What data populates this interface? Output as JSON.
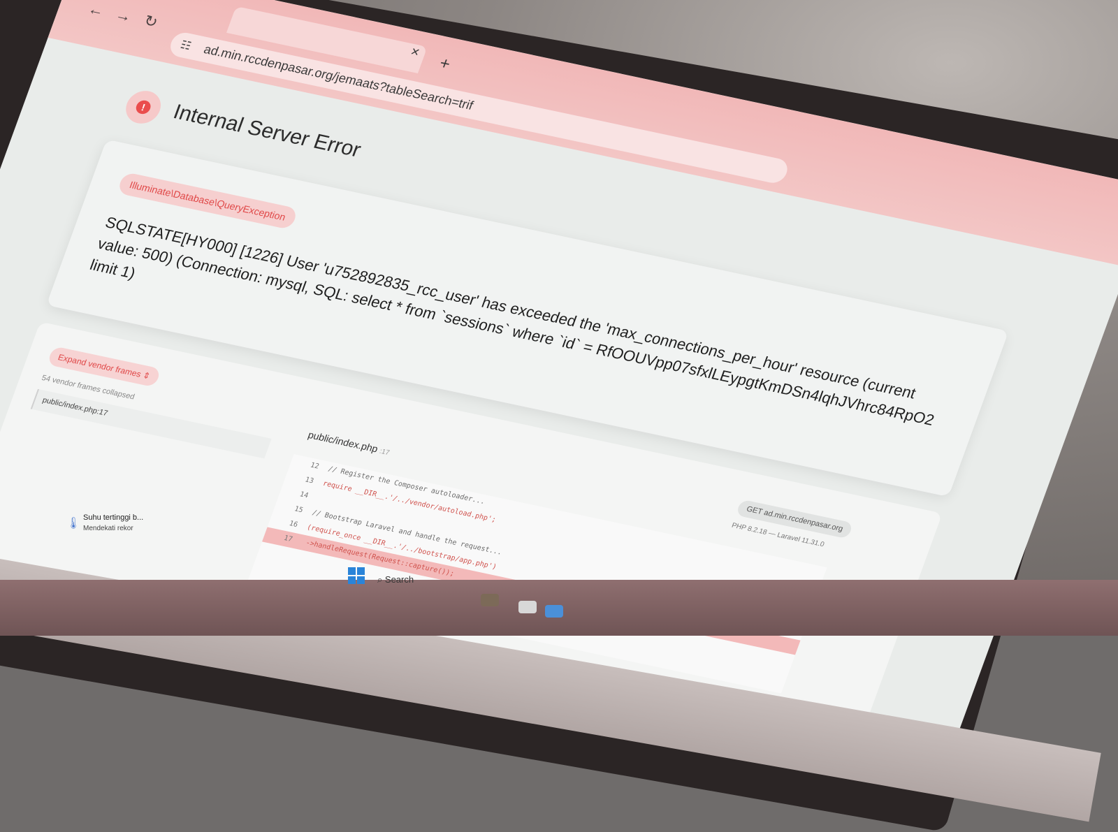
{
  "browser": {
    "url": "ad.min.rccdenpasar.org/jemaats?tableSearch=trif",
    "new_tab_label": "+",
    "tab_close_label": "×",
    "back_label": "←",
    "forward_label": "→",
    "reload_label": "↻"
  },
  "error": {
    "title": "Internal Server Error",
    "badge": "!",
    "exception_class": "Illuminate\\Database\\QueryException",
    "message": "SQLSTATE[HY000] [1226] User 'u752892835_rcc_user' has exceeded the 'max_connections_per_hour' resource (current value: 500) (Connection: mysql, SQL: select * from `sessions` where `id` = RfOOUVpp07sfxlLEypgtKmDSn4lqhJVhrc84RpO2 limit 1)"
  },
  "trace": {
    "expand_label": "Expand vendor frames",
    "expand_icon": "⇕",
    "collapsed_note": "54 vendor frames collapsed",
    "frame_label": "public/index.php:17",
    "file": "public/index.php",
    "file_line": ":17",
    "request": "GET ad.min.rccdenpasar.org",
    "versions": "PHP 8.2.18 — Laravel 11.31.0",
    "code": [
      {
        "n": "12",
        "text": "// Register the Composer autoloader...",
        "cls": "c-comment"
      },
      {
        "n": "13",
        "text": "require __DIR__.'/../vendor/autoload.php';",
        "cls": "c-red"
      },
      {
        "n": "14",
        "text": "",
        "cls": ""
      },
      {
        "n": "15",
        "text": "// Bootstrap Laravel and handle the request...",
        "cls": "c-comment"
      },
      {
        "n": "16",
        "text": "(require_once __DIR__.'/../bootstrap/app.php')",
        "cls": "c-red"
      },
      {
        "n": "17",
        "text": "    ->handleRequest(Request::capture());",
        "cls": "c-red"
      }
    ],
    "active_line": "17"
  },
  "taskbar": {
    "weather_title": "Suhu tertinggi b...",
    "weather_sub": "Mendekati rekor",
    "search_label": "Search",
    "search_icon": "⌕",
    "weather_icon": "🌡"
  }
}
